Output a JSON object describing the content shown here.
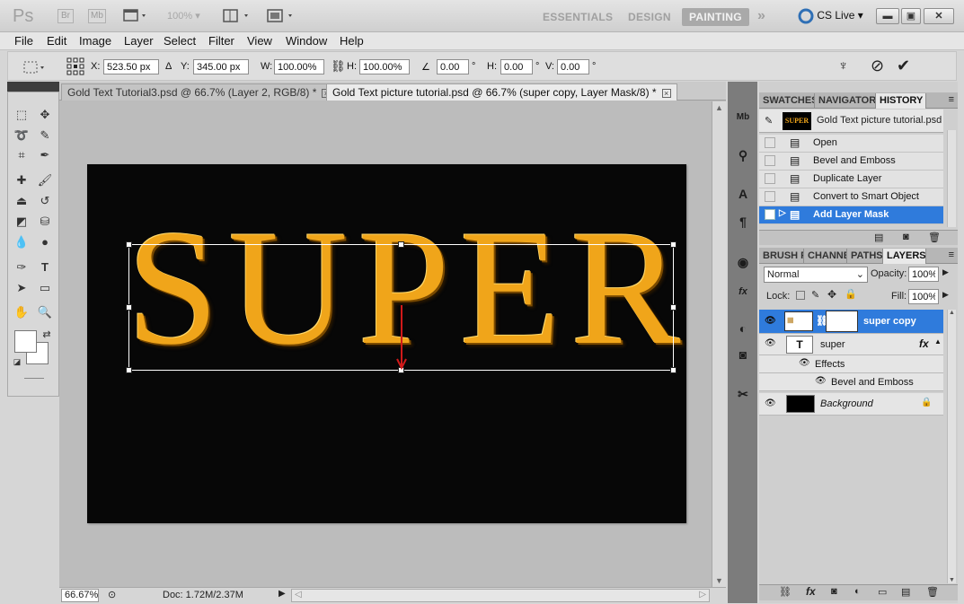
{
  "app": {
    "logo": "Ps",
    "bridge_btn": "Br",
    "minibridge_btn": "Mb",
    "zoom_dropdown": "100%",
    "workspaces": [
      "ESSENTIALS",
      "DESIGN",
      "PAINTING"
    ],
    "active_workspace": "PAINTING",
    "more_workspaces": "»",
    "cs_live": "CS Live",
    "window_controls": [
      "minimize",
      "restore",
      "close"
    ]
  },
  "menu": [
    "File",
    "Edit",
    "Image",
    "Layer",
    "Select",
    "Filter",
    "View",
    "Window",
    "Help"
  ],
  "options_bar": {
    "x_label": "X:",
    "x_value": "523.50 px",
    "y_label": "Y:",
    "y_value": "345.00 px",
    "w_label": "W:",
    "w_value": "100.00%",
    "h_label": "H:",
    "h_value": "100.00%",
    "angle_value": "0.00",
    "hskew_label": "H:",
    "hskew_value": "0.00",
    "vskew_label": "V:",
    "vskew_value": "0.00",
    "degree": "°"
  },
  "document_tabs": [
    {
      "label": "Gold Text Tutorial3.psd @ 66.7% (Layer 2, RGB/8) *",
      "active": false
    },
    {
      "label": "Gold Text picture tutorial.psd @ 66.7% (super copy, Layer Mask/8) *",
      "active": true
    }
  ],
  "canvas": {
    "text": "SUPER",
    "text_color": "#f0a51a",
    "background": "#070707"
  },
  "status": {
    "zoom": "66.67%",
    "doc_info": "Doc: 1.72M/2.37M"
  },
  "history_panel": {
    "tabs": [
      "SWATCHES",
      "NAVIGATOR",
      "HISTORY"
    ],
    "active_tab": "HISTORY",
    "snapshot_label": "Gold Text picture tutorial.psd",
    "snapshot_thumb_text": "SUPER",
    "items": [
      "Open",
      "Bevel and Emboss",
      "Duplicate Layer",
      "Convert to Smart Object",
      "Add Layer Mask"
    ],
    "selected_index": 4
  },
  "layers_panel": {
    "tabs": [
      "BRUSH P",
      "CHANNE",
      "PATHS",
      "LAYERS"
    ],
    "active_tab": "LAYERS",
    "blend_mode": "Normal",
    "opacity_label": "Opacity:",
    "opacity_value": "100%",
    "lock_label": "Lock:",
    "fill_label": "Fill:",
    "fill_value": "100%",
    "layers": [
      {
        "name": "super copy",
        "selected": true
      },
      {
        "name": "super",
        "type": "text",
        "effects_label": "Effects",
        "effect": "Bevel and Emboss"
      },
      {
        "name": "Background",
        "locked": true
      }
    ],
    "fx": "fx"
  },
  "colors": {
    "selection_blue": "#2f7bdc",
    "gold": "#f0a51a"
  }
}
